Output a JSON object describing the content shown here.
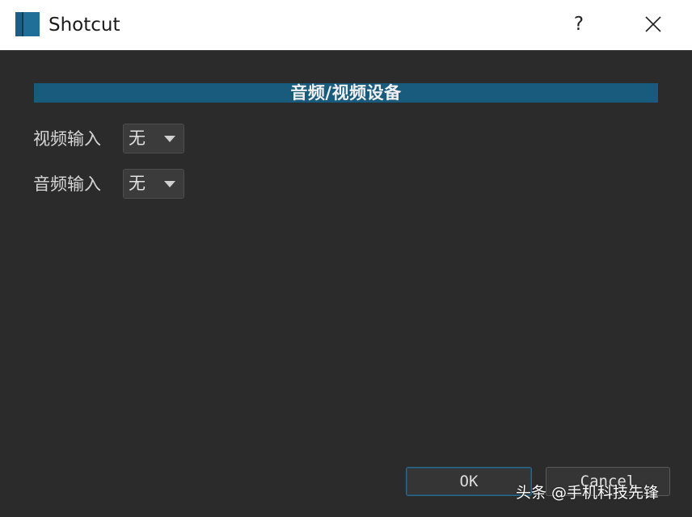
{
  "window": {
    "title": "Shotcut",
    "help_label": "?",
    "icon": "shotcut-app-icon",
    "close_icon": "close-icon"
  },
  "section": {
    "title": "音频/视频设备"
  },
  "fields": {
    "video_input": {
      "label": "视频输入",
      "value": "无"
    },
    "audio_input": {
      "label": "音频输入",
      "value": "无"
    }
  },
  "buttons": {
    "ok_label": "OK",
    "cancel_label": "Cancel"
  },
  "watermark": {
    "text": "头条 @手机科技先锋"
  },
  "colors": {
    "titlebar_bg": "#ffffff",
    "window_bg": "#2b2b2b",
    "section_header_bg": "#195b7d",
    "accent_border": "#2e6a8c",
    "text_light": "#d6d6d6"
  }
}
